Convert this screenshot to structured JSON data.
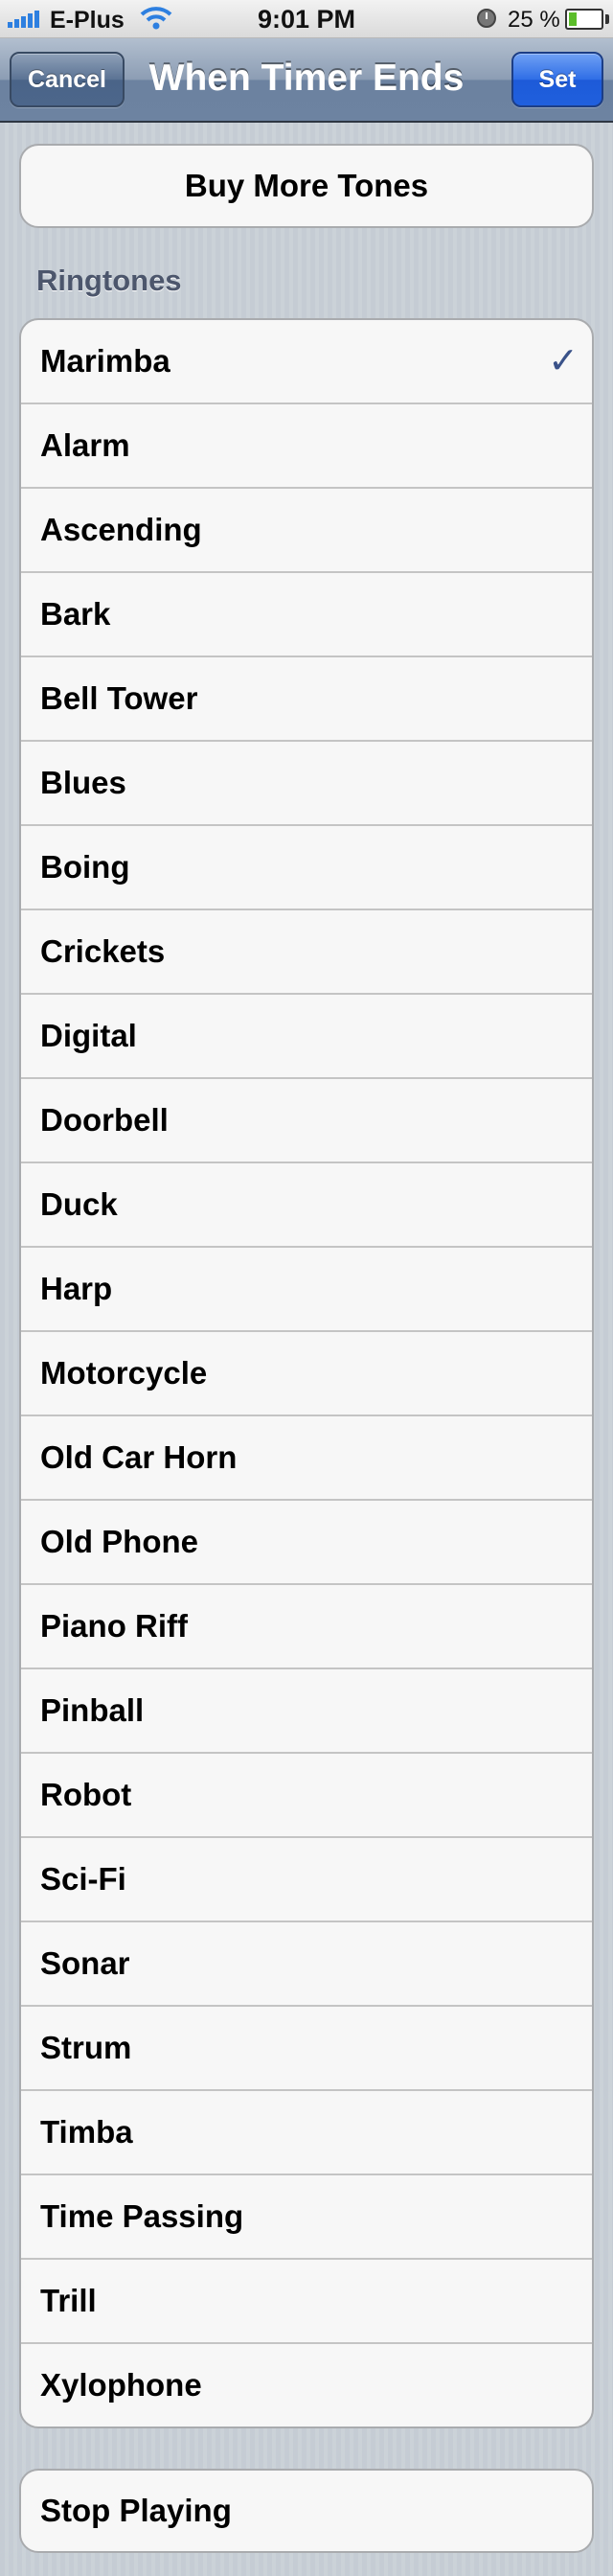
{
  "status_bar": {
    "carrier": "E-Plus",
    "time": "9:01 PM",
    "battery_percent_text": "25 %",
    "battery_level": 0.25,
    "icons": [
      "signal-bars-icon",
      "wifi-icon",
      "alarm-clock-icon",
      "battery-icon"
    ]
  },
  "nav": {
    "title": "When Timer Ends",
    "cancel_label": "Cancel",
    "set_label": "Set"
  },
  "buy_more_label": "Buy More Tones",
  "ringtones": {
    "header": "Ringtones",
    "selected_index": 0,
    "checkmark": "✓",
    "items": [
      "Marimba",
      "Alarm",
      "Ascending",
      "Bark",
      "Bell Tower",
      "Blues",
      "Boing",
      "Crickets",
      "Digital",
      "Doorbell",
      "Duck",
      "Harp",
      "Motorcycle",
      "Old Car Horn",
      "Old Phone",
      "Piano Riff",
      "Pinball",
      "Robot",
      "Sci-Fi",
      "Sonar",
      "Strum",
      "Timba",
      "Time Passing",
      "Trill",
      "Xylophone"
    ]
  },
  "stop_playing_label": "Stop Playing",
  "colors": {
    "nav_bar": "#7387a3",
    "set_button": "#2f6ee6",
    "checkmark": "#3a5289",
    "section_header": "#4c566c",
    "background": "#c5ccd4"
  }
}
